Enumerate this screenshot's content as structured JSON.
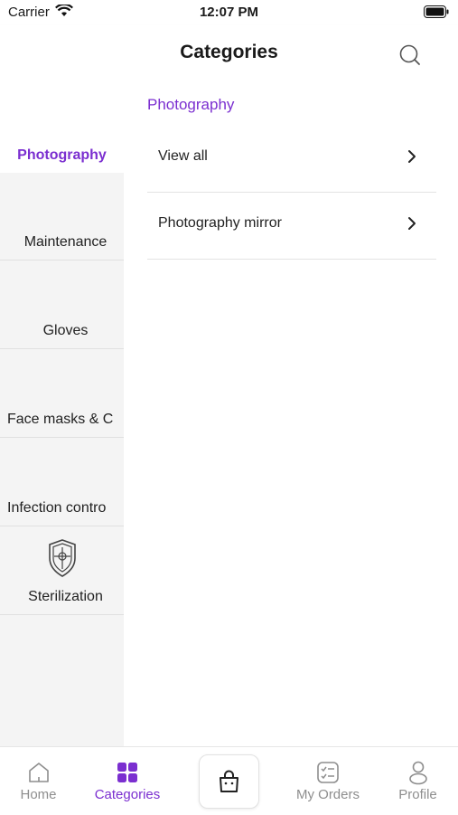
{
  "status_bar": {
    "carrier": "Carrier",
    "time": "12:07 PM"
  },
  "header": {
    "title": "Categories",
    "search_icon": "search-icon"
  },
  "sidebar": {
    "items": [
      {
        "label": "Photography",
        "active": true
      },
      {
        "label": "Maintenance"
      },
      {
        "label": "Gloves"
      },
      {
        "label": "Face masks & C"
      },
      {
        "label": "Infection contro"
      },
      {
        "label": "Sterilization",
        "icon": "shield-icon"
      }
    ]
  },
  "main": {
    "section_title": "Photography",
    "rows": [
      {
        "label": "View all"
      },
      {
        "label": "Photography mirror"
      }
    ]
  },
  "tabbar": {
    "tabs": [
      {
        "label": "Home",
        "icon": "home-icon"
      },
      {
        "label": "Categories",
        "icon": "grid-icon",
        "active": true
      },
      {
        "label": "",
        "icon": "bag-icon"
      },
      {
        "label": "My Orders",
        "icon": "orders-icon"
      },
      {
        "label": "Profile",
        "icon": "profile-icon"
      }
    ]
  },
  "colors": {
    "accent": "#7b2fd0",
    "sidebar_bg": "#f4f4f4",
    "inactive_tab": "#8e8e8e"
  }
}
